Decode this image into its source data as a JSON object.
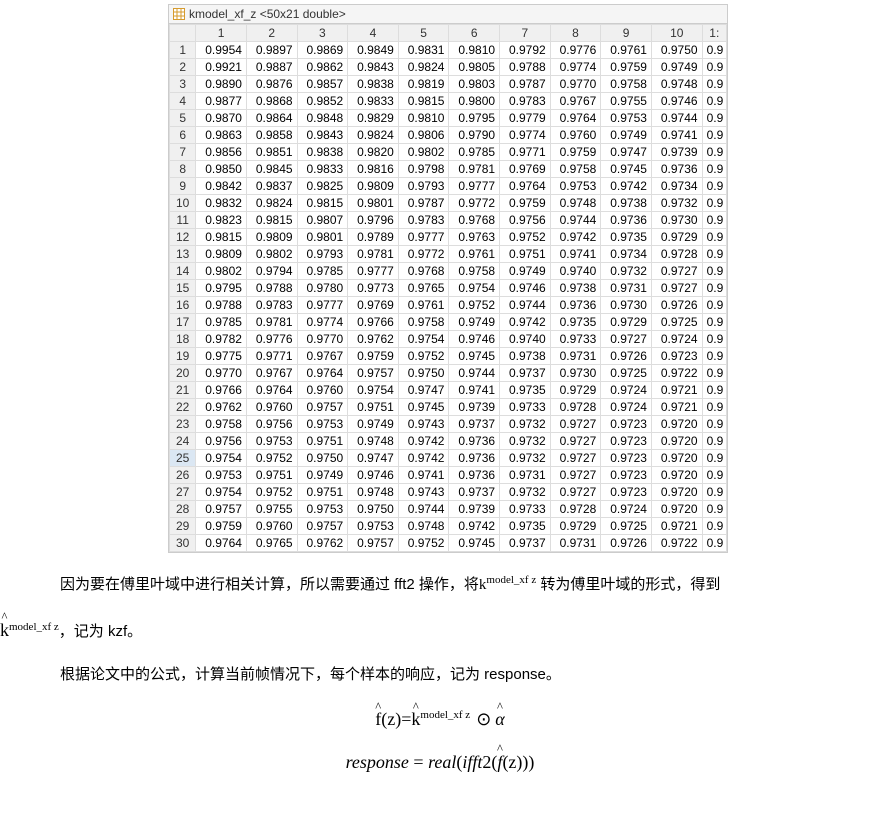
{
  "panel": {
    "title": "kmodel_xf_z <50x21 double>",
    "col_headers": [
      "1",
      "2",
      "3",
      "4",
      "5",
      "6",
      "7",
      "8",
      "9",
      "10",
      "1:"
    ],
    "row_headers": [
      "1",
      "2",
      "3",
      "4",
      "5",
      "6",
      "7",
      "8",
      "9",
      "10",
      "11",
      "12",
      "13",
      "14",
      "15",
      "16",
      "17",
      "18",
      "19",
      "20",
      "21",
      "22",
      "23",
      "24",
      "25",
      "26",
      "27",
      "28",
      "29",
      "30"
    ],
    "rows": [
      [
        "0.9954",
        "0.9897",
        "0.9869",
        "0.9849",
        "0.9831",
        "0.9810",
        "0.9792",
        "0.9776",
        "0.9761",
        "0.9750",
        "0.9"
      ],
      [
        "0.9921",
        "0.9887",
        "0.9862",
        "0.9843",
        "0.9824",
        "0.9805",
        "0.9788",
        "0.9774",
        "0.9759",
        "0.9749",
        "0.9"
      ],
      [
        "0.9890",
        "0.9876",
        "0.9857",
        "0.9838",
        "0.9819",
        "0.9803",
        "0.9787",
        "0.9770",
        "0.9758",
        "0.9748",
        "0.9"
      ],
      [
        "0.9877",
        "0.9868",
        "0.9852",
        "0.9833",
        "0.9815",
        "0.9800",
        "0.9783",
        "0.9767",
        "0.9755",
        "0.9746",
        "0.9"
      ],
      [
        "0.9870",
        "0.9864",
        "0.9848",
        "0.9829",
        "0.9810",
        "0.9795",
        "0.9779",
        "0.9764",
        "0.9753",
        "0.9744",
        "0.9"
      ],
      [
        "0.9863",
        "0.9858",
        "0.9843",
        "0.9824",
        "0.9806",
        "0.9790",
        "0.9774",
        "0.9760",
        "0.9749",
        "0.9741",
        "0.9"
      ],
      [
        "0.9856",
        "0.9851",
        "0.9838",
        "0.9820",
        "0.9802",
        "0.9785",
        "0.9771",
        "0.9759",
        "0.9747",
        "0.9739",
        "0.9"
      ],
      [
        "0.9850",
        "0.9845",
        "0.9833",
        "0.9816",
        "0.9798",
        "0.9781",
        "0.9769",
        "0.9758",
        "0.9745",
        "0.9736",
        "0.9"
      ],
      [
        "0.9842",
        "0.9837",
        "0.9825",
        "0.9809",
        "0.9793",
        "0.9777",
        "0.9764",
        "0.9753",
        "0.9742",
        "0.9734",
        "0.9"
      ],
      [
        "0.9832",
        "0.9824",
        "0.9815",
        "0.9801",
        "0.9787",
        "0.9772",
        "0.9759",
        "0.9748",
        "0.9738",
        "0.9732",
        "0.9"
      ],
      [
        "0.9823",
        "0.9815",
        "0.9807",
        "0.9796",
        "0.9783",
        "0.9768",
        "0.9756",
        "0.9744",
        "0.9736",
        "0.9730",
        "0.9"
      ],
      [
        "0.9815",
        "0.9809",
        "0.9801",
        "0.9789",
        "0.9777",
        "0.9763",
        "0.9752",
        "0.9742",
        "0.9735",
        "0.9729",
        "0.9"
      ],
      [
        "0.9809",
        "0.9802",
        "0.9793",
        "0.9781",
        "0.9772",
        "0.9761",
        "0.9751",
        "0.9741",
        "0.9734",
        "0.9728",
        "0.9"
      ],
      [
        "0.9802",
        "0.9794",
        "0.9785",
        "0.9777",
        "0.9768",
        "0.9758",
        "0.9749",
        "0.9740",
        "0.9732",
        "0.9727",
        "0.9"
      ],
      [
        "0.9795",
        "0.9788",
        "0.9780",
        "0.9773",
        "0.9765",
        "0.9754",
        "0.9746",
        "0.9738",
        "0.9731",
        "0.9727",
        "0.9"
      ],
      [
        "0.9788",
        "0.9783",
        "0.9777",
        "0.9769",
        "0.9761",
        "0.9752",
        "0.9744",
        "0.9736",
        "0.9730",
        "0.9726",
        "0.9"
      ],
      [
        "0.9785",
        "0.9781",
        "0.9774",
        "0.9766",
        "0.9758",
        "0.9749",
        "0.9742",
        "0.9735",
        "0.9729",
        "0.9725",
        "0.9"
      ],
      [
        "0.9782",
        "0.9776",
        "0.9770",
        "0.9762",
        "0.9754",
        "0.9746",
        "0.9740",
        "0.9733",
        "0.9727",
        "0.9724",
        "0.9"
      ],
      [
        "0.9775",
        "0.9771",
        "0.9767",
        "0.9759",
        "0.9752",
        "0.9745",
        "0.9738",
        "0.9731",
        "0.9726",
        "0.9723",
        "0.9"
      ],
      [
        "0.9770",
        "0.9767",
        "0.9764",
        "0.9757",
        "0.9750",
        "0.9744",
        "0.9737",
        "0.9730",
        "0.9725",
        "0.9722",
        "0.9"
      ],
      [
        "0.9766",
        "0.9764",
        "0.9760",
        "0.9754",
        "0.9747",
        "0.9741",
        "0.9735",
        "0.9729",
        "0.9724",
        "0.9721",
        "0.9"
      ],
      [
        "0.9762",
        "0.9760",
        "0.9757",
        "0.9751",
        "0.9745",
        "0.9739",
        "0.9733",
        "0.9728",
        "0.9724",
        "0.9721",
        "0.9"
      ],
      [
        "0.9758",
        "0.9756",
        "0.9753",
        "0.9749",
        "0.9743",
        "0.9737",
        "0.9732",
        "0.9727",
        "0.9723",
        "0.9720",
        "0.9"
      ],
      [
        "0.9756",
        "0.9753",
        "0.9751",
        "0.9748",
        "0.9742",
        "0.9736",
        "0.9732",
        "0.9727",
        "0.9723",
        "0.9720",
        "0.9"
      ],
      [
        "0.9754",
        "0.9752",
        "0.9750",
        "0.9747",
        "0.9742",
        "0.9736",
        "0.9732",
        "0.9727",
        "0.9723",
        "0.9720",
        "0.9"
      ],
      [
        "0.9753",
        "0.9751",
        "0.9749",
        "0.9746",
        "0.9741",
        "0.9736",
        "0.9731",
        "0.9727",
        "0.9723",
        "0.9720",
        "0.9"
      ],
      [
        "0.9754",
        "0.9752",
        "0.9751",
        "0.9748",
        "0.9743",
        "0.9737",
        "0.9732",
        "0.9727",
        "0.9723",
        "0.9720",
        "0.9"
      ],
      [
        "0.9757",
        "0.9755",
        "0.9753",
        "0.9750",
        "0.9744",
        "0.9739",
        "0.9733",
        "0.9728",
        "0.9724",
        "0.9720",
        "0.9"
      ],
      [
        "0.9759",
        "0.9760",
        "0.9757",
        "0.9753",
        "0.9748",
        "0.9742",
        "0.9735",
        "0.9729",
        "0.9725",
        "0.9721",
        "0.9"
      ],
      [
        "0.9764",
        "0.9765",
        "0.9762",
        "0.9757",
        "0.9752",
        "0.9745",
        "0.9737",
        "0.9731",
        "0.9726",
        "0.9722",
        "0.9"
      ]
    ],
    "selected_row": 25
  },
  "text": {
    "p1a": "因为要在傅里叶域中进行相关计算，所以需要通过 fft2 操作，将",
    "p1b": "转为傅里叶域的形式，得到",
    "p1_sup": "model_xf z",
    "p2a": "，记为 kzf。",
    "p2_sup": "model_xf z",
    "p3": "根据论文中的公式，计算当前帧情况下，每个样本的响应，记为 response。",
    "eq1_lhs_f": "f",
    "eq1_lhs_z": "(z)=",
    "eq1_k": "k",
    "eq1_sup": "model_xf z",
    "eq1_odot": "⊙",
    "eq1_alpha": "α",
    "eq2_resp": "response",
    "eq2_eq": " = ",
    "eq2_real": "real",
    "eq2_open": "(",
    "eq2_ifft": "ifft",
    "eq2_2": "2(",
    "eq2_f": "f",
    "eq2_z": "(z)))"
  }
}
